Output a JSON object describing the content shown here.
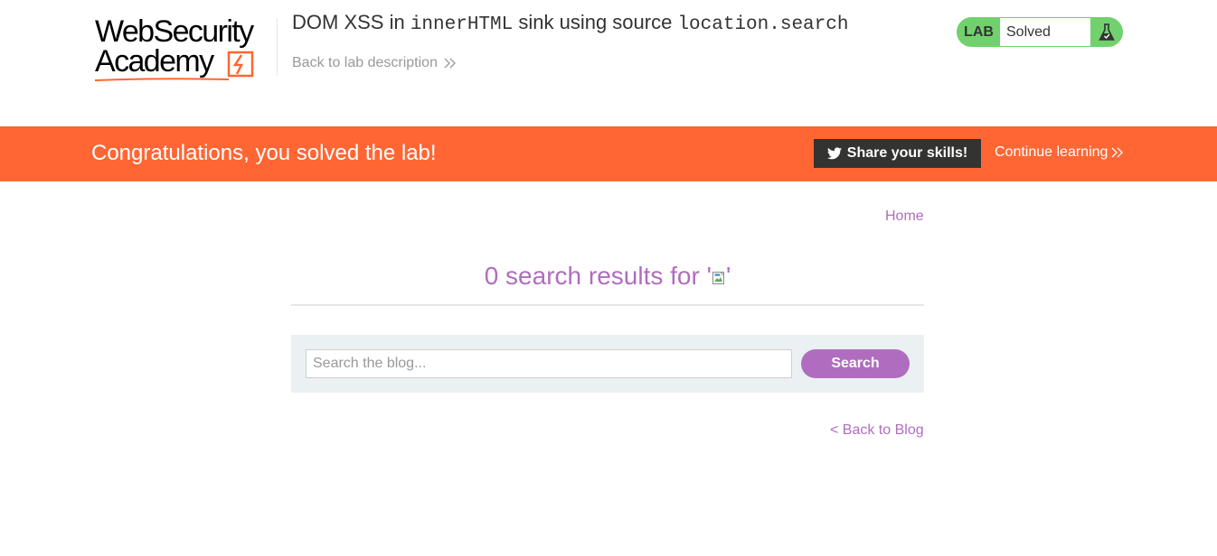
{
  "header": {
    "logo": {
      "line1": "WebSecurity",
      "line2": "Academy"
    },
    "lab_title_parts": [
      "DOM XSS in ",
      "innerHTML",
      " sink using source ",
      "location.search"
    ],
    "back_to_description": "Back to lab description",
    "lab_status": {
      "tag": "LAB",
      "state": "Solved",
      "icon": "flask-icon",
      "color": "#70d16d"
    }
  },
  "banner": {
    "message": "Congratulations, you solved the lab!",
    "share_label": "Share your skills!",
    "share_icon": "twitter-icon",
    "continue_label": "Continue learning",
    "color": "#ff6633"
  },
  "nav": {
    "home": "Home"
  },
  "search": {
    "results_prefix": "0 search results for '",
    "results_suffix": "'",
    "placeholder": "Search the blog...",
    "button_label": "Search",
    "accent": "#b06dbf"
  },
  "footer": {
    "back_to_blog": "< Back to Blog"
  }
}
